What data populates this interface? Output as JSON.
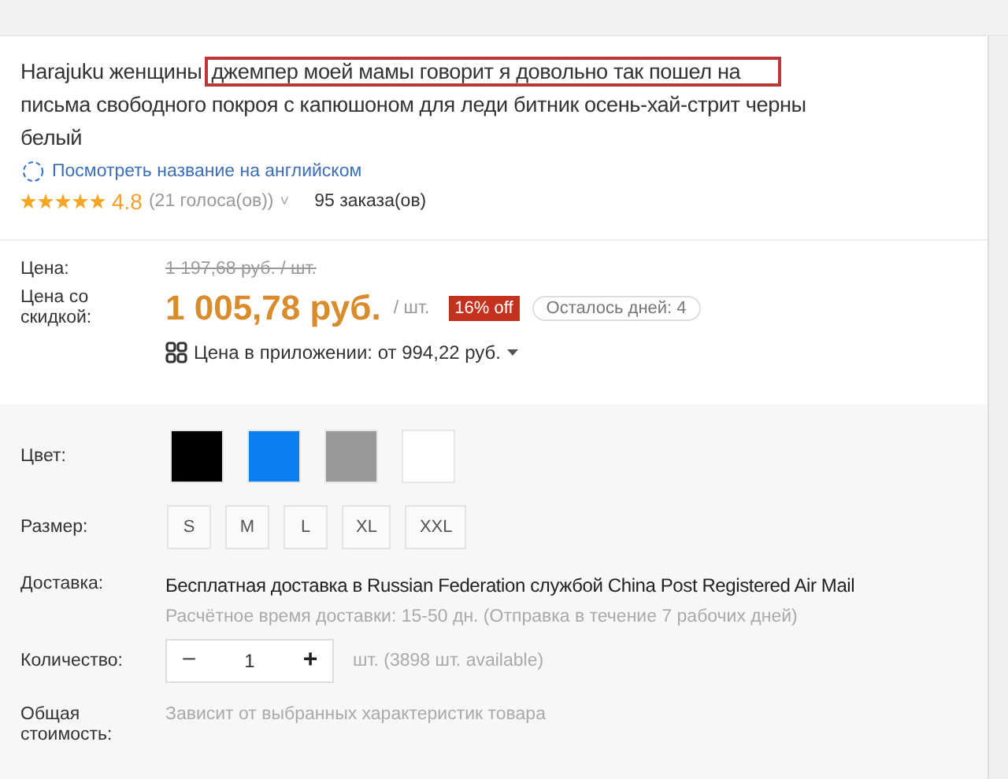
{
  "product": {
    "title_start": "Harajuku женщины",
    "title_highlight": "джемпер моей мамы говорит я довольно так пошел на",
    "title_line_2": "письма свободного покроя с капюшоном для леди битник осень-хай-стрит черны",
    "title_line_3": "белый",
    "translate_link": "Посмотреть название на английском",
    "stars": 5,
    "rating": "4.8",
    "votes": "(21 голоса(ов))",
    "votes_caret": "˅",
    "orders": "95 заказа(ов)"
  },
  "price": {
    "label": "Цена:",
    "old_price": "1 197,68 руб. / шт.",
    "discount_label": "Цена со скидкой:",
    "price": "1 005,78 руб.",
    "unit": "/ шт.",
    "off_badge": "16% off",
    "days_left": "Осталось дней: 4",
    "app_price": "Цена в приложении: от 994,22 руб."
  },
  "options": {
    "color_label": "Цвет:",
    "colors": [
      {
        "color": "#000000"
      },
      {
        "color": "#0a7ff0"
      },
      {
        "color": "#999999"
      },
      {
        "color": "#ffffff"
      }
    ],
    "size_label": "Размер:",
    "sizes": [
      "S",
      "M",
      "L",
      "XL",
      "XXL"
    ],
    "shipping_label": "Доставка:",
    "shipping": "Бесплатная доставка в Russian Federation службой China Post Registered Air Mail",
    "shipping_time": "Расчётное время доставки: 15-50 дн. (Отправка в течение 7 рабочих дней)",
    "quantity_label": "Количество:",
    "minus": "−",
    "quantity": "1",
    "plus": "+",
    "available": "шт. (3898 шт. available)",
    "total_label": "Общая стоимость:",
    "total": "Зависит от выбранных характеристик товара"
  }
}
